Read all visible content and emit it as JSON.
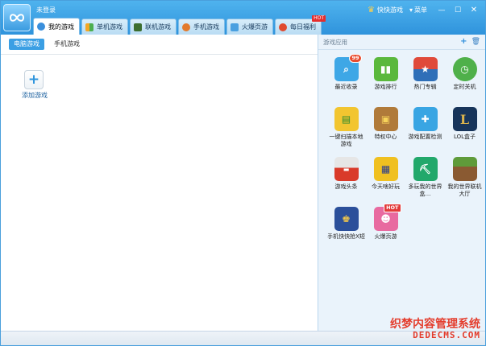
{
  "window": {
    "login_status": "未登录"
  },
  "tabs": [
    {
      "label": "我的游戏",
      "icon": "gamepad-icon",
      "color": "#3a8fdc",
      "active": true
    },
    {
      "label": "单机游戏",
      "icon": "tiles-icon",
      "color": "#f5a623",
      "active": false
    },
    {
      "label": "联机游戏",
      "icon": "cube-icon",
      "color": "#3c6e2f",
      "active": false
    },
    {
      "label": "手机游戏",
      "icon": "phone-icon",
      "color": "#e37a2c",
      "active": false
    },
    {
      "label": "火爆页游",
      "icon": "bubble-icon",
      "color": "#4aa0e0",
      "active": false
    },
    {
      "label": "每日福利",
      "icon": "gift-icon",
      "color": "#e04a2f",
      "active": false,
      "badge": "HOT"
    }
  ],
  "topbar": {
    "quick_game": "快快游戏",
    "menu": "菜单"
  },
  "subtabs": [
    {
      "label": "电脑游戏",
      "active": true
    },
    {
      "label": "手机游戏",
      "active": false
    }
  ],
  "add_game": {
    "label": "添加游戏"
  },
  "apps_panel": {
    "title": "游戏应用",
    "apps": [
      {
        "label": "最近收录",
        "icon": "recent-icon",
        "bg": "#3ea7e6",
        "badge": "99"
      },
      {
        "label": "游戏排行",
        "icon": "ranking-icon",
        "bg": "#5ab83c"
      },
      {
        "label": "热门专辑",
        "icon": "album-icon",
        "bg": "#2f6fb8"
      },
      {
        "label": "定时关机",
        "icon": "timer-icon",
        "bg": "#4fb04a"
      },
      {
        "label": "一键扫描本地游戏",
        "icon": "scan-folder-icon",
        "bg": "#f2c530"
      },
      {
        "label": "特权中心",
        "icon": "treasure-chest-icon",
        "bg": "#b07a3a"
      },
      {
        "label": "游戏配置检测",
        "icon": "toolbox-icon",
        "bg": "#39a5e3"
      },
      {
        "label": "LOL盒子",
        "icon": "lol-icon",
        "bg": "#17345a"
      },
      {
        "label": "游戏头条",
        "icon": "news-icon",
        "bg": "#d9d9d9"
      },
      {
        "label": "今天啥好玩",
        "icon": "arcade-icon",
        "bg": "#f0c020"
      },
      {
        "label": "多玩我的世界盒…",
        "icon": "pickaxe-icon",
        "bg": "#22a86b"
      },
      {
        "label": "我的世界联机大厅",
        "icon": "grass-block-icon",
        "bg": "#5f9b3a"
      },
      {
        "label": "手机快快抢X短",
        "icon": "king-icon",
        "bg": "#2b4f9a"
      },
      {
        "label": "火爆页游",
        "icon": "cartoon-icon",
        "bg": "#e86aa0",
        "badge": "HOT"
      }
    ]
  },
  "watermark": {
    "line1": "织梦内容管理系统",
    "line2": "DEDECMS.COM"
  }
}
